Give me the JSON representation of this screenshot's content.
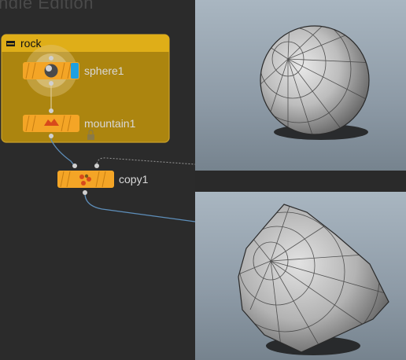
{
  "window": {
    "edition_text": "ndle Edition"
  },
  "network": {
    "subnet": {
      "name": "rock"
    },
    "nodes": [
      {
        "name": "sphere1"
      },
      {
        "name": "mountain1"
      },
      {
        "name": "copy1"
      }
    ]
  },
  "viewports": [
    {
      "content": "sphere"
    },
    {
      "content": "deformed-rock"
    }
  ],
  "colors": {
    "subnet_fill": "#ac850f",
    "node_fill": "#f4a526",
    "display_flag": "#1ea0e0",
    "wire": "#5e8fbb",
    "background": "#2b2b2b"
  }
}
